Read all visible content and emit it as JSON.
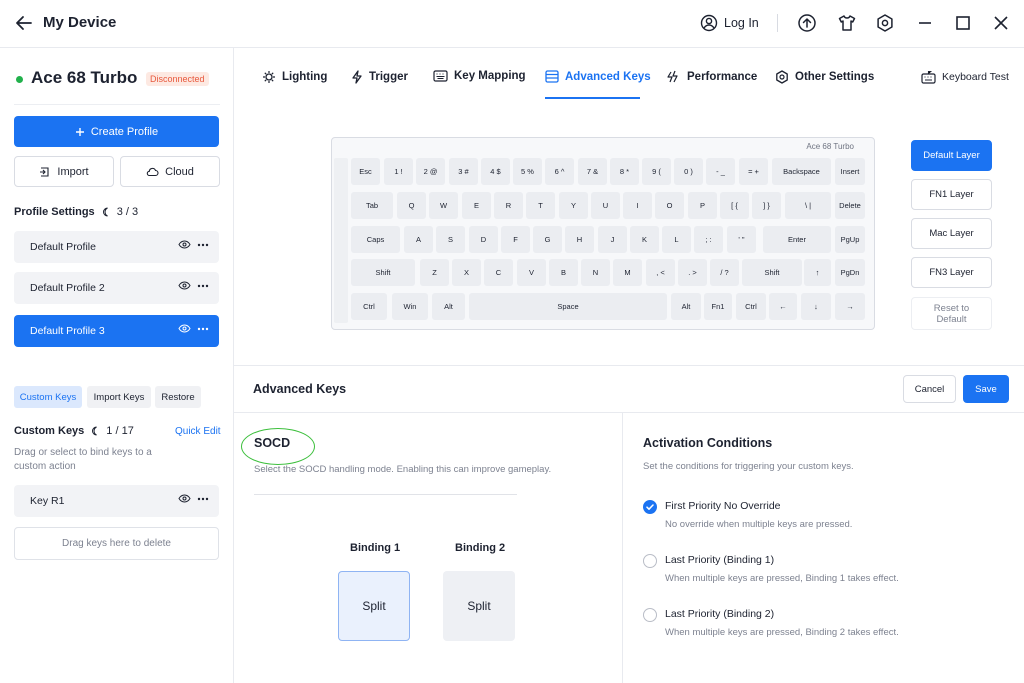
{
  "titlebar": {
    "title": "My Device",
    "login_label": "Log In",
    "icons": [
      "arrow-left-icon",
      "user-circle-icon",
      "upload-circle-icon",
      "tshirt-icon",
      "hexagon-settings-icon",
      "minimize-icon",
      "maximize-icon",
      "close-icon"
    ]
  },
  "sidebar": {
    "device_name": "Ace 68 Turbo",
    "device_status": "Disconnected",
    "create_profile": "Create Profile",
    "import": "Import",
    "cloud": "Cloud",
    "profile_settings_title": "Profile Settings",
    "profile_settings_count": "3 / 3",
    "profiles": [
      {
        "label": "Default Profile",
        "active": false
      },
      {
        "label": "Default Profile 2",
        "active": false
      },
      {
        "label": "Default Profile 3",
        "active": true
      }
    ],
    "chips": [
      "Custom Keys",
      "Import Keys",
      "Restore"
    ],
    "custom_keys_title": "Custom Keys",
    "custom_keys_count": "1 / 17",
    "quick_edit": "Quick Edit",
    "hint": "Drag or select to bind keys to a custom action",
    "custom_key_item": "Key R1",
    "drop_zone": "Drag keys here to delete"
  },
  "tabs": [
    {
      "label": "Lighting",
      "icon": "bulb-icon",
      "active": false
    },
    {
      "label": "Trigger",
      "icon": "lightning-icon",
      "active": false
    },
    {
      "label": "Key Mapping",
      "icon": "keyboard-icon",
      "active": false
    },
    {
      "label": "Advanced Keys",
      "icon": "layers-icon",
      "active": true
    },
    {
      "label": "Performance",
      "icon": "speed-icon",
      "active": false
    },
    {
      "label": "Other Settings",
      "icon": "gear-icon",
      "active": false
    },
    {
      "label": "Keyboard Test",
      "icon": "keyboard-test-icon",
      "active": false
    }
  ],
  "keyboard": {
    "label": "Ace 68 Turbo",
    "rows": [
      [
        "Esc",
        "1 !",
        "2 @",
        "3 #",
        "4 $",
        "5 %",
        "6 ^",
        "7 &",
        "8 *",
        "9 (",
        "0 )",
        "- _",
        "= +",
        "Backspace",
        "Insert"
      ],
      [
        "Tab",
        "Q",
        "W",
        "E",
        "R",
        "T",
        "Y",
        "U",
        "I",
        "O",
        "P",
        "[ {",
        "] }",
        "\\ |",
        "Delete"
      ],
      [
        "Caps",
        "A",
        "S",
        "D",
        "F",
        "G",
        "H",
        "J",
        "K",
        "L",
        "; :",
        "' \"",
        "Enter",
        "PgUp"
      ],
      [
        "Shift",
        "Z",
        "X",
        "C",
        "V",
        "B",
        "N",
        "M",
        ", <",
        ". >",
        "/ ?",
        "Shift",
        "↑",
        "PgDn"
      ],
      [
        "Ctrl",
        "Win",
        "Alt",
        "Space",
        "Alt",
        "Fn1",
        "Ctrl",
        "←",
        "↓",
        "→"
      ]
    ]
  },
  "layers": [
    {
      "label": "Default Layer",
      "state": "active"
    },
    {
      "label": "FN1 Layer",
      "state": "normal"
    },
    {
      "label": "Mac Layer",
      "state": "normal"
    },
    {
      "label": "FN3 Layer",
      "state": "normal"
    },
    {
      "label": "Reset to Default",
      "state": "disabled"
    }
  ],
  "advanced": {
    "title": "Advanced Keys",
    "cancel": "Cancel",
    "save": "Save",
    "socd_title": "SOCD",
    "socd_desc": "Select the SOCD handling mode. Enabling this can improve gameplay.",
    "binding1_label": "Binding 1",
    "binding2_label": "Binding 2",
    "binding1_value": "Split",
    "binding2_value": "Split",
    "ac_title": "Activation Conditions",
    "ac_desc": "Set the conditions for triggering your custom keys.",
    "options": [
      {
        "title": "First Priority No Override",
        "desc": "No override when multiple keys are pressed.",
        "selected": true
      },
      {
        "title": "Last Priority (Binding 1)",
        "desc": "When multiple keys are pressed, Binding 1 takes effect.",
        "selected": false
      },
      {
        "title": "Last Priority (Binding 2)",
        "desc": "When multiple keys are pressed, Binding 2 takes effect.",
        "selected": false
      }
    ]
  },
  "colors": {
    "accent": "#1b73f2",
    "status_red": "#e8593d",
    "online_green": "#22b14c",
    "highlight_ring": "#3cbf3c"
  }
}
